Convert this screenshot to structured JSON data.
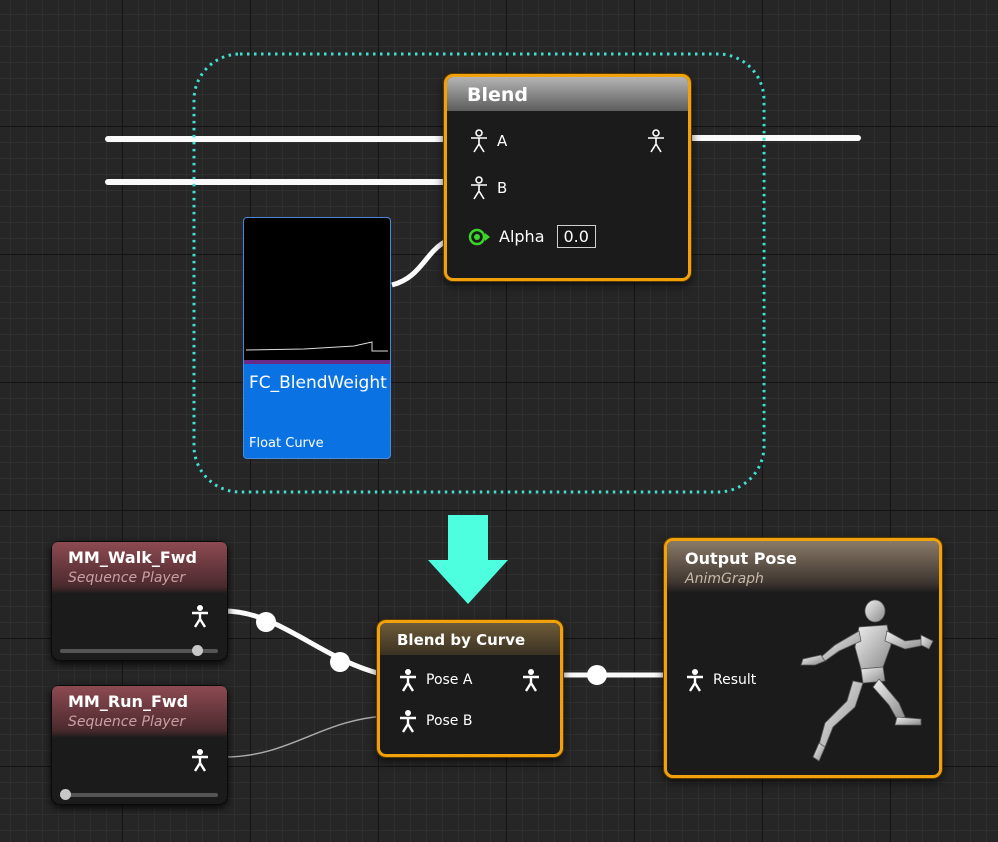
{
  "blend_node": {
    "title": "Blend",
    "pins": {
      "a": "A",
      "b": "B",
      "alpha": "Alpha"
    },
    "alpha_value": "0.0"
  },
  "float_curve": {
    "name": "FC_BlendWeight",
    "type": "Float Curve"
  },
  "walk_node": {
    "title": "MM_Walk_Fwd",
    "subtitle": "Sequence Player",
    "slider_position": 0.9
  },
  "run_node": {
    "title": "MM_Run_Fwd",
    "subtitle": "Sequence Player",
    "slider_position": 0.0
  },
  "blend_curve_node": {
    "title": "Blend by Curve",
    "pins": {
      "pose_a": "Pose A",
      "pose_b": "Pose B"
    }
  },
  "output_node": {
    "title": "Output Pose",
    "subtitle": "AnimGraph",
    "pins": {
      "result": "Result"
    }
  },
  "icons": {
    "pose_pin": "pose-icon",
    "alpha_pin": "float-pin-icon",
    "arrow": "arrow-down-icon",
    "mannequin": "mannequin-running-icon"
  },
  "colors": {
    "selection": "#f0a10c",
    "dashed_outline": "#40e0d0",
    "arrow": "#4dffdf",
    "float_curve_bg": "#0a72e3",
    "sequence_header": "#7a3d44",
    "blend_by_curve_header": "#5a4a2f",
    "alpha_pin": "#3bd62a"
  }
}
